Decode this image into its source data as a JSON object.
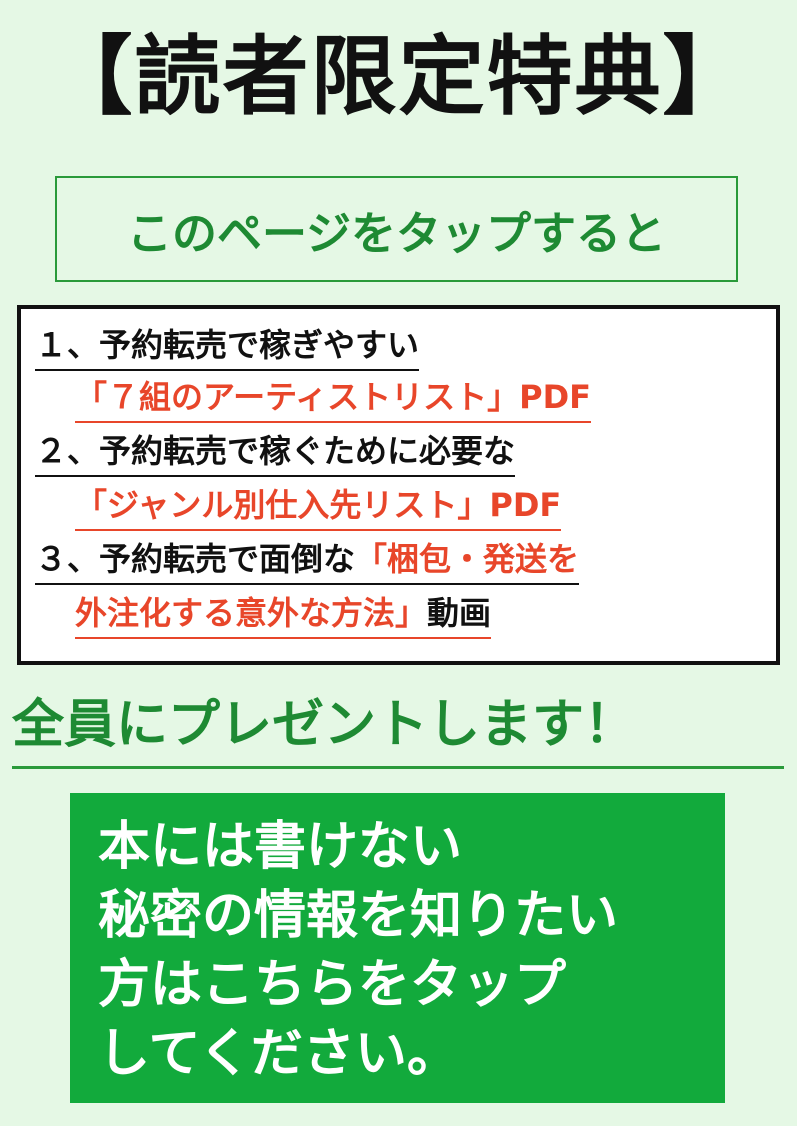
{
  "title": "【読者限定特典】",
  "tap_prompt": "このページをタップすると",
  "items": [
    {
      "line1_black": "１、予約転売で稼ぎやすい",
      "line2_red": "「７組のアーティストリスト」PDF"
    },
    {
      "line1_black": "２、予約転売で稼ぐために必要な",
      "line2_red": "「ジャンル別仕入先リスト」PDF"
    },
    {
      "line1_black": "３、予約転売で面倒な",
      "line1_red": "「梱包・発送を",
      "line2_red": "外注化する意外な方法」",
      "line2_black": "動画"
    }
  ],
  "present": "全員にプレゼントします！",
  "cta_lines": [
    "本には書けない",
    "秘密の情報を知りたい",
    "方はこちらをタップ",
    "してください。"
  ],
  "colors": {
    "background": "#e5f8e5",
    "green_text": "#1e8a33",
    "red_text": "#e8462a",
    "cta_background": "#12aa3c"
  }
}
